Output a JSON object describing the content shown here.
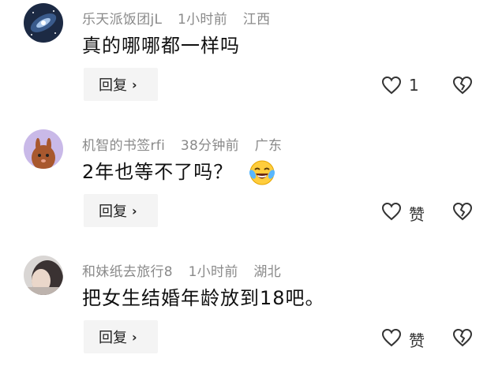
{
  "comments": [
    {
      "username": "乐天派饭团jL",
      "time": "1小时前",
      "location": "江西",
      "text": "真的哪哪都一样吗",
      "reply_label": "回复",
      "like_label": "1"
    },
    {
      "username": "机智的书签rfi",
      "time": "38分钟前",
      "location": "广东",
      "text": "2年也等不了吗？",
      "reply_label": "回复",
      "like_label": "赞"
    },
    {
      "username": "和妹纸去旅行8",
      "time": "1小时前",
      "location": "湖北",
      "text": "把女生结婚年龄放到18吧。",
      "reply_label": "回复",
      "like_label": "赞"
    }
  ],
  "icons": {
    "like": "heart-outline-icon",
    "dislike": "broken-heart-icon",
    "reply_chevron": "chevron-right-icon",
    "emoji": "crying-laughing-emoji"
  }
}
